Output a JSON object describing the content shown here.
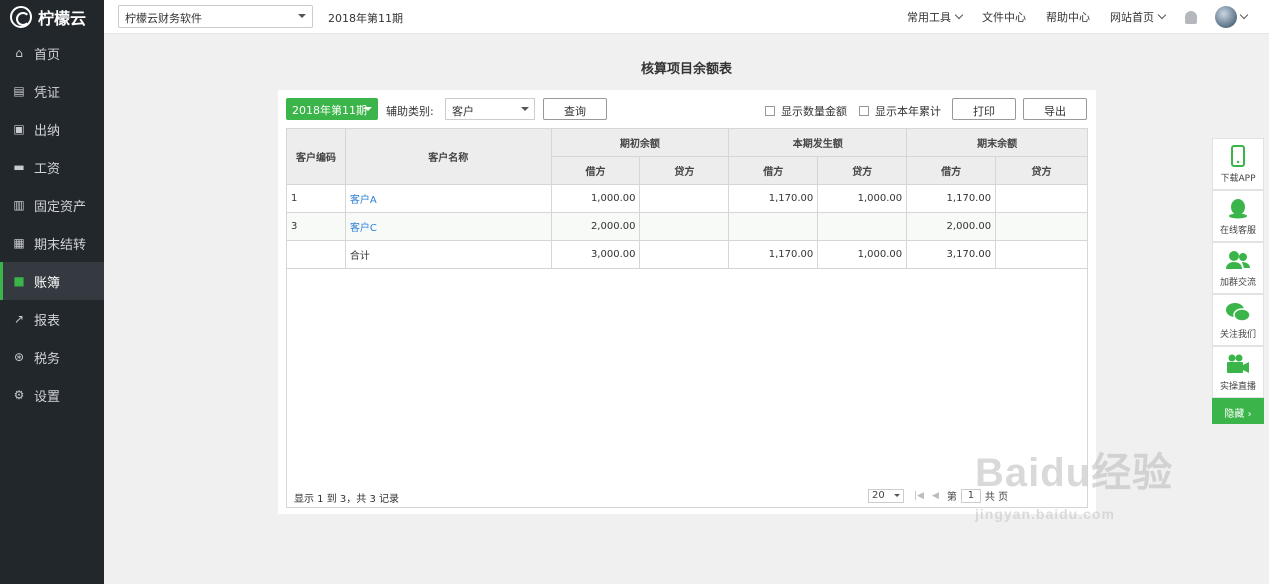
{
  "app": {
    "name": "柠檬云"
  },
  "sidebar": {
    "items": [
      {
        "label": "首页",
        "icon": "home-icon"
      },
      {
        "label": "凭证",
        "icon": "voucher-icon"
      },
      {
        "label": "出纳",
        "icon": "cashier-icon"
      },
      {
        "label": "工资",
        "icon": "salary-icon"
      },
      {
        "label": "固定资产",
        "icon": "asset-icon"
      },
      {
        "label": "期末结转",
        "icon": "calendar-icon"
      },
      {
        "label": "账簿",
        "icon": "book-icon",
        "active": true
      },
      {
        "label": "报表",
        "icon": "chart-icon"
      },
      {
        "label": "税务",
        "icon": "tax-icon"
      },
      {
        "label": "设置",
        "icon": "gear-icon"
      }
    ]
  },
  "topbar": {
    "company": "柠檬云财务软件",
    "period": "2018年第11期",
    "links": {
      "tools": "常用工具",
      "files": "文件中心",
      "help": "帮助中心",
      "site": "网站首页"
    }
  },
  "page": {
    "title": "核算项目余额表"
  },
  "toolbar": {
    "period_btn": "2018年第11期",
    "aux_label": "辅助类别:",
    "aux_value": "客户",
    "query": "查询",
    "show_qty": "显示数量金额",
    "show_year": "显示本年累计",
    "print": "打印",
    "export": "导出"
  },
  "table": {
    "headers": {
      "code": "客户编码",
      "name": "客户名称",
      "opening": "期初余额",
      "period": "本期发生额",
      "closing": "期末余额",
      "debit": "借方",
      "credit": "贷方"
    },
    "rows": [
      {
        "code": "1",
        "name": "客户A",
        "od": "1,000.00",
        "oc": "",
        "pd": "1,170.00",
        "pc": "1,000.00",
        "cd": "1,170.00",
        "cc": ""
      },
      {
        "code": "3",
        "name": "客户C",
        "od": "2,000.00",
        "oc": "",
        "pd": "",
        "pc": "",
        "cd": "2,000.00",
        "cc": ""
      },
      {
        "code": "",
        "name": "合计",
        "od": "3,000.00",
        "oc": "",
        "pd": "1,170.00",
        "pc": "1,000.00",
        "cd": "3,170.00",
        "cc": ""
      }
    ]
  },
  "footer": {
    "summary": "显示 1 到 3，共 3 记录",
    "page_size": "20",
    "page_prefix": "第",
    "page_num": "1",
    "page_suffix": "共 页"
  },
  "float": {
    "app": "下载APP",
    "service": "在线客服",
    "group": "加群交流",
    "follow": "关注我们",
    "live": "实操直播",
    "hide": "隐藏 ›"
  },
  "watermark": {
    "logo": "Baidu经验",
    "url": "jingyan.baidu.com"
  },
  "colors": {
    "accent": "#3bb54a",
    "sidebar": "#22272b",
    "link": "#2f7fd8"
  }
}
